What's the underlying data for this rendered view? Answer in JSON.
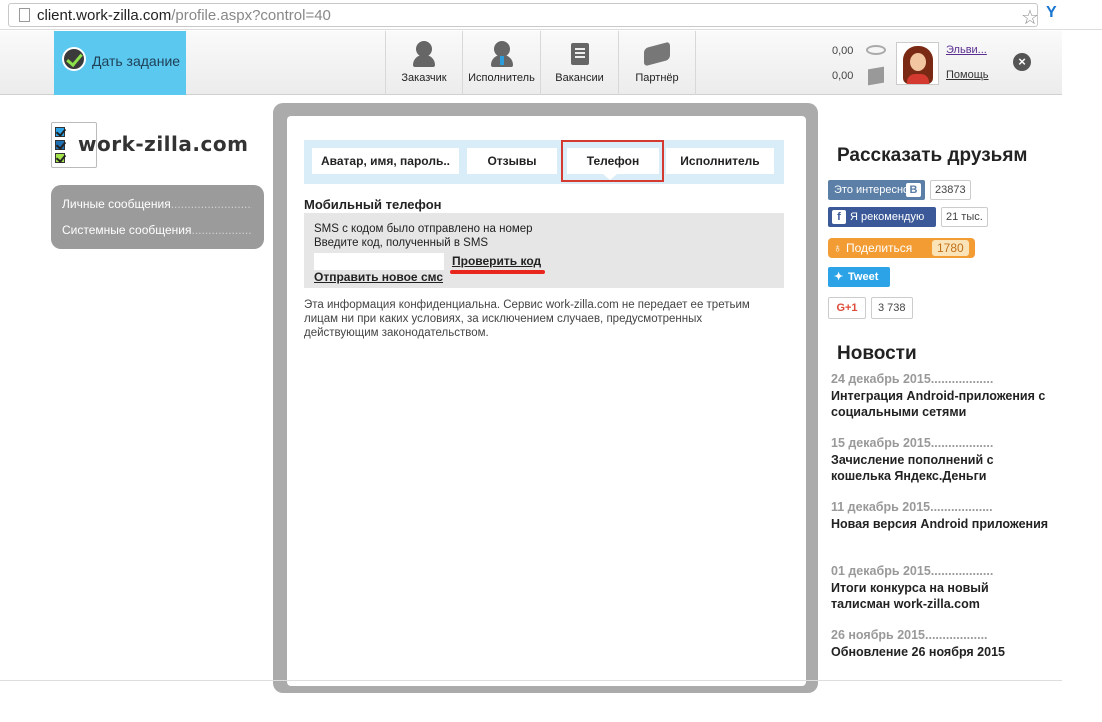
{
  "browser": {
    "url_host": "client.work-zilla.com",
    "url_path": "/profile.aspx?control=40",
    "star_icon": "star-icon",
    "extension_icon": "Y"
  },
  "topbar": {
    "task_button": "Дать задание",
    "nav": [
      {
        "label": "Заказчик",
        "icon": "customer-icon"
      },
      {
        "label": "Исполнитель",
        "icon": "freelancer-icon"
      },
      {
        "label": "Вакансии",
        "icon": "vacancies-icon"
      },
      {
        "label": "Партнёр",
        "icon": "partner-icon"
      }
    ],
    "balance_1": "0,00",
    "balance_2": "0,00",
    "user_name": "Эльви...",
    "help": "Помощь"
  },
  "logo": {
    "text": "work-zilla.com"
  },
  "left_menu": {
    "items": [
      {
        "label": "Личные сообщения",
        "dots": "........................................"
      },
      {
        "label": "Системные сообщения",
        "dots": "........................................"
      }
    ]
  },
  "tabs": [
    {
      "label": "Аватар, имя, пароль.."
    },
    {
      "label": "Отзывы"
    },
    {
      "label": "Телефон"
    },
    {
      "label": "Исполнитель"
    }
  ],
  "phone": {
    "title": "Мобильный телефон",
    "sent_text": "SMS с кодом было отправлено на номер",
    "enter_text": "Введите код, полученный в SMS",
    "code_value": "",
    "check_link": "Проверить код",
    "resend_link": "Отправить новое смс",
    "confidential": "Эта информация конфиденциальна. Сервис work-zilla.com не передает ее третьим лицам ни при каких условиях, за исключением случаев, предусмотренных действующим законодательством."
  },
  "share": {
    "title": "Рассказать друзьям",
    "vk_label": "Это интересно",
    "vk_badge": "В",
    "vk_count": "23873",
    "fb_label": "Я рекомендую",
    "fb_count": "21 тыс.",
    "ok_label": "Поделиться",
    "ok_count": "1780",
    "tw_label": "Tweet",
    "gp_label": "G+1",
    "gp_count": "3 738",
    "colors": {
      "vk": "#5b7fa6",
      "fb": "#3b5998",
      "ok": "#f39c33",
      "tw": "#2ba3e6",
      "gp": "#dd4b39"
    }
  },
  "news": {
    "title": "Новости",
    "items": [
      {
        "date": "24 декабрь 2015..................",
        "text": "Интеграция Android-приложения с социальными сетями"
      },
      {
        "date": "15 декабрь 2015..................",
        "text": "Зачисление пополнений с кошелька Яндекс.Деньги"
      },
      {
        "date": "11 декабрь 2015..................",
        "text": "Новая версия Android приложения"
      },
      {
        "date": "01 декабрь 2015..................",
        "text": "Итоги конкурса на новый талисман work-zilla.com"
      },
      {
        "date": "26 ноябрь 2015..................",
        "text": "Обновление 26 ноября 2015"
      }
    ]
  }
}
